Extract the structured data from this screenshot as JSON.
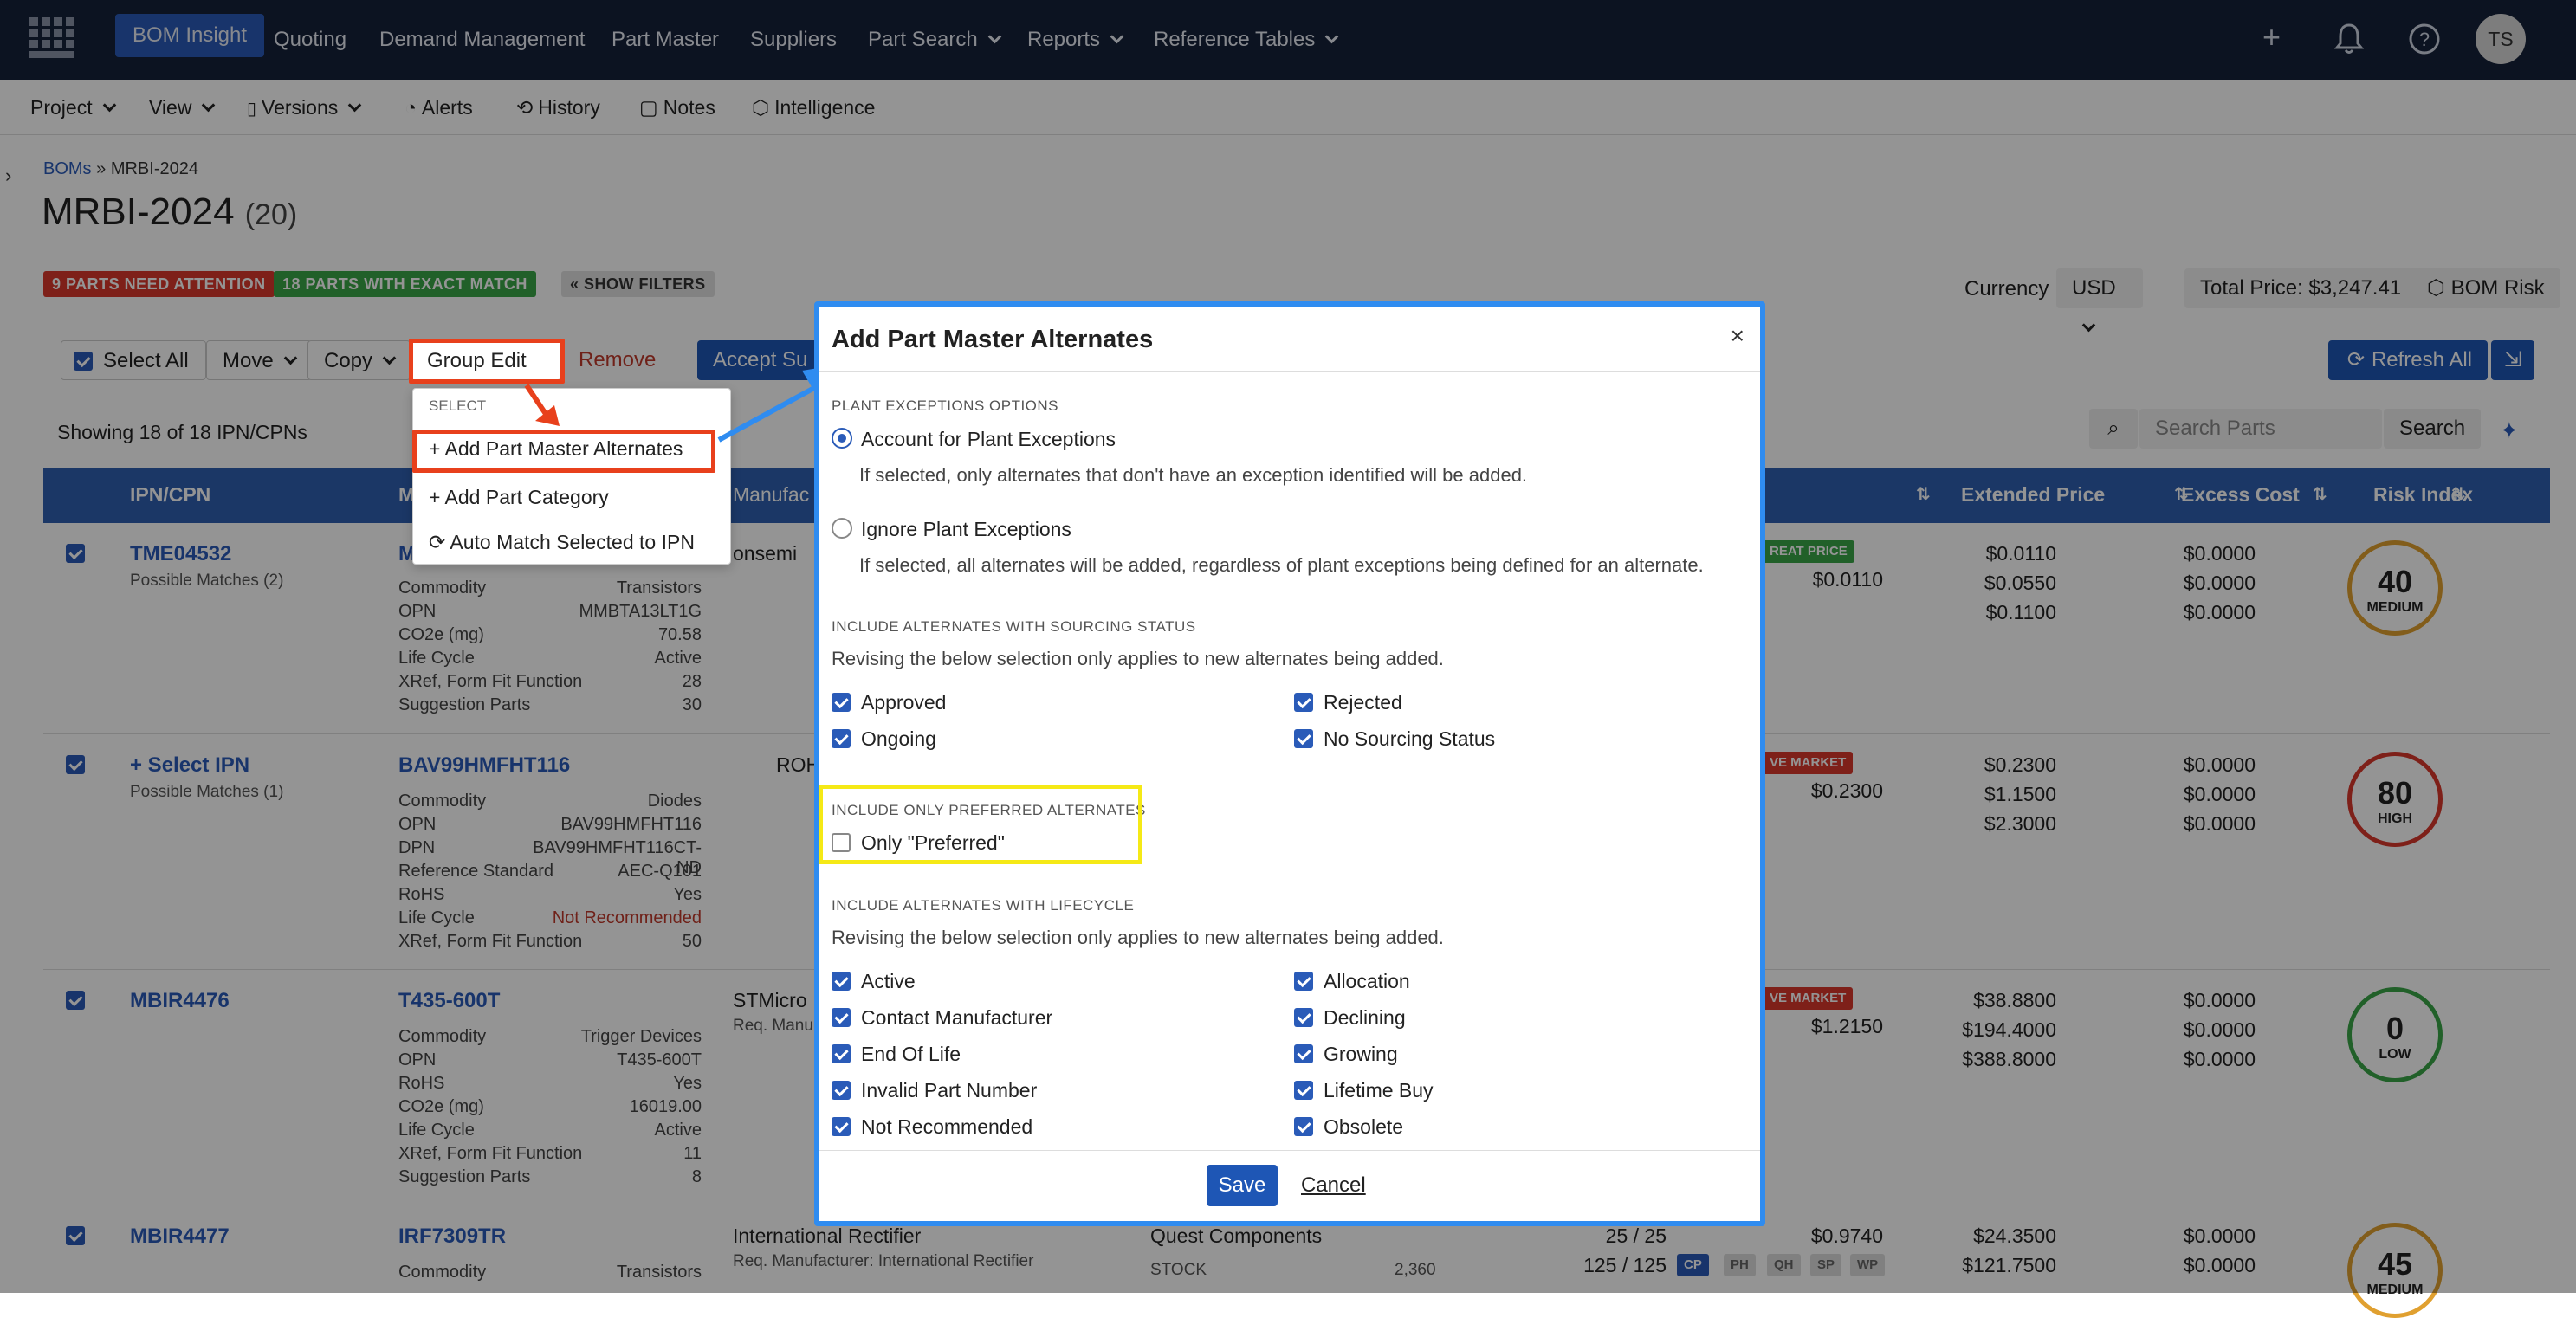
{
  "topnav": {
    "brand": "BOM Insight",
    "items": [
      "Quoting",
      "Demand Management",
      "Part Master",
      "Suppliers",
      "Part Search",
      "Reports",
      "Reference Tables"
    ],
    "avatar": "TS"
  },
  "subbar": {
    "items": [
      "Project",
      "View",
      "Versions",
      "Alerts",
      "History",
      "Notes",
      "Intelligence"
    ]
  },
  "breadcrumb": {
    "root": "BOMs",
    "sep": "»",
    "current": "MRBI-2024"
  },
  "page": {
    "title": "MRBI-2024",
    "count": "(20)",
    "badge_attention": "9 PARTS NEED ATTENTION",
    "badge_exact": "18 PARTS WITH EXACT MATCH",
    "show_filters": "« SHOW FILTERS",
    "currency_label": "Currency",
    "currency_value": "USD",
    "total_price": "Total Price: $3,247.41",
    "bom_risk": "BOM Risk",
    "showing": "Showing 18 of 18 IPN/CPNs",
    "search_placeholder": "Search Parts",
    "search_btn": "Search"
  },
  "toolbar": {
    "select_all": "Select All",
    "move": "Move",
    "copy": "Copy",
    "group_edit": "Group Edit",
    "remove": "Remove",
    "accept": "Accept Su",
    "refresh_all": "Refresh All"
  },
  "group_menu": {
    "header": "SELECT",
    "items": [
      "+ Add Part Master Alternates",
      "+ Add Part Category",
      "Auto Match Selected to IPN"
    ]
  },
  "table": {
    "headers": [
      "IPN/CPN",
      "M",
      "Manufac",
      "Extended Price",
      "Excess Cost",
      "Risk Index"
    ],
    "rows": [
      {
        "ipn": "TME04532",
        "sub": "Possible Matches (2)",
        "mpn": "M",
        "mfr": "onsemi",
        "kv": [
          [
            "Commodity",
            "Transistors"
          ],
          [
            "OPN",
            "MMBTA13LT1G"
          ],
          [
            "CO2e (mg)",
            "70.58"
          ],
          [
            "Life Cycle",
            "Active"
          ],
          [
            "XRef, Form Fit Function",
            "28"
          ],
          [
            "Suggestion Parts",
            "30"
          ]
        ],
        "tag": "REAT PRICE",
        "unit": "$0.0110",
        "ext": [
          "$0.0110",
          "$0.0550",
          "$0.1100"
        ],
        "excess": [
          "$0.0000",
          "$0.0000",
          "$0.0000"
        ],
        "risk": "40",
        "risk_label": "MEDIUM"
      },
      {
        "ipn": "+ Select IPN",
        "sub": "Possible Matches (1)",
        "mpn": "BAV99HMFHT116",
        "mfr": "ROHM S",
        "kv": [
          [
            "Commodity",
            "Diodes"
          ],
          [
            "OPN",
            "BAV99HMFHT116"
          ],
          [
            "DPN",
            "BAV99HMFHT116CT-ND"
          ],
          [
            "Reference Standard",
            "AEC-Q101"
          ],
          [
            "RoHS",
            "Yes"
          ],
          [
            "Life Cycle",
            "Not Recommended"
          ],
          [
            "XRef, Form Fit Function",
            "50"
          ]
        ],
        "tag": "VE MARKET",
        "unit": "$0.2300",
        "ext": [
          "$0.2300",
          "$1.1500",
          "$2.3000"
        ],
        "excess": [
          "$0.0000",
          "$0.0000",
          "$0.0000"
        ],
        "risk": "80",
        "risk_label": "HIGH"
      },
      {
        "ipn": "MBIR4476",
        "sub": "",
        "mpn": "T435-600T",
        "mfr": "STMicro",
        "mfr2": "Req. Manu",
        "kv": [
          [
            "Commodity",
            "Trigger Devices"
          ],
          [
            "OPN",
            "T435-600T"
          ],
          [
            "RoHS",
            "Yes"
          ],
          [
            "CO2e (mg)",
            "16019.00"
          ],
          [
            "Life Cycle",
            "Active"
          ],
          [
            "XRef, Form Fit Function",
            "11"
          ],
          [
            "Suggestion Parts",
            "8"
          ]
        ],
        "tag": "VE MARKET",
        "unit": "$1.2150",
        "ext": [
          "$38.8800",
          "$194.4000",
          "$388.8000"
        ],
        "excess": [
          "$0.0000",
          "$0.0000",
          "$0.0000"
        ],
        "risk": "0",
        "risk_label": "LOW"
      },
      {
        "ipn": "MBIR4477",
        "sub": "",
        "mpn": "IRF7309TR",
        "mfr": "International Rectifier",
        "mfr2": "Req. Manufacturer: International Rectifier",
        "supplier": "Quest Components",
        "stock_label": "STOCK",
        "stock": "2,360",
        "qty": [
          "25 / 25",
          "125 / 125"
        ],
        "kv": [
          [
            "Commodity",
            "Transistors"
          ]
        ],
        "unit": "$0.9740",
        "ext": [
          "$24.3500",
          "$121.7500"
        ],
        "excess": [
          "$0.0000",
          "$0.0000"
        ],
        "risk": "45",
        "risk_label": "MEDIUM"
      }
    ],
    "status_tags": [
      "CP",
      "PH",
      "QH",
      "SP",
      "WP"
    ]
  },
  "modal": {
    "title": "Add Part Master Alternates",
    "close": "×",
    "sec_plant": "PLANT EXCEPTIONS OPTIONS",
    "opt1": "Account for Plant Exceptions",
    "opt1_desc": "If selected, only alternates that don't have an exception identified will be added.",
    "opt2": "Ignore Plant Exceptions",
    "opt2_desc": "If selected, all alternates will be added, regardless of plant exceptions being defined for an alternate.",
    "sec_sourcing": "INCLUDE ALTERNATES WITH SOURCING STATUS",
    "sourcing_desc": "Revising the below selection only applies to new alternates being added.",
    "sourcing": [
      "Approved",
      "Rejected",
      "Ongoing",
      "No Sourcing Status"
    ],
    "sec_pref": "INCLUDE ONLY PREFERRED ALTERNATES",
    "pref": "Only \"Preferred\"",
    "sec_life": "INCLUDE ALTERNATES WITH LIFECYCLE",
    "life_desc": "Revising the below selection only applies to new alternates being added.",
    "lifecycle": [
      "Active",
      "Allocation",
      "Contact Manufacturer",
      "Declining",
      "End Of Life",
      "Growing",
      "Invalid Part Number",
      "Lifetime Buy",
      "Not Recommended",
      "Obsolete"
    ],
    "save": "Save",
    "cancel": "Cancel"
  },
  "colors": {
    "nav_bg": "#16213a",
    "accent": "#2a5bb8",
    "modal_border": "#2f8cf0",
    "highlight_red": "#e8401c",
    "highlight_yellow": "#f5e916",
    "attention": "#d9382c",
    "exact": "#3aa548"
  }
}
